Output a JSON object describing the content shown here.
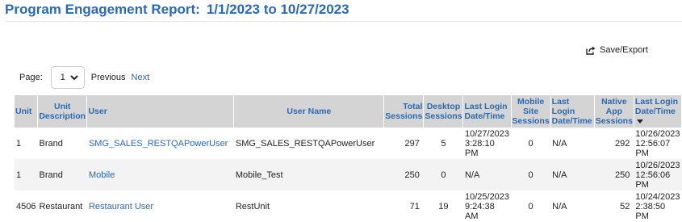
{
  "header": {
    "title": "Program Engagement Report:",
    "date_range": "1/1/2023 to 10/27/2023"
  },
  "toolbar": {
    "save_export_label": "Save/Export",
    "save_icon": "export-icon"
  },
  "pager": {
    "page_label": "Page:",
    "current_page": "1",
    "previous_label": "Previous",
    "next_label": "Next"
  },
  "table": {
    "columns": [
      "Unit",
      "Unit Description",
      "User",
      "User Name",
      "Total Sessions",
      "Desktop Sessions",
      "Last Login Date/Time",
      "Mobile Site Sessions",
      "Last Login Date/Time",
      "Native App Sessions",
      "Last Login Date/Time"
    ],
    "rows": [
      [
        "1",
        "Brand",
        "SMG_SALES_RESTQAPowerUser",
        "SMG_SALES_RESTQAPowerUser",
        "297",
        "5",
        "10/27/2023 3:28:10 PM",
        "0",
        "N/A",
        "292",
        "10/26/2023 12:56:07 PM"
      ],
      [
        "1",
        "Brand",
        "Mobile",
        "Mobile_Test",
        "250",
        "0",
        "N/A",
        "0",
        "N/A",
        "250",
        "10/26/2023 12:56:06 PM"
      ],
      [
        "4506",
        "Restaurant",
        "Restaurant User",
        "RestUnit",
        "71",
        "19",
        "10/25/2023 9:24:38 AM",
        "0",
        "N/A",
        "52",
        "10/24/2023 2:38:50 PM"
      ]
    ]
  },
  "colors": {
    "accent": "#2a6ab4",
    "header_bg": "#d4d4d4",
    "alt_row": "#f3f3f3"
  }
}
